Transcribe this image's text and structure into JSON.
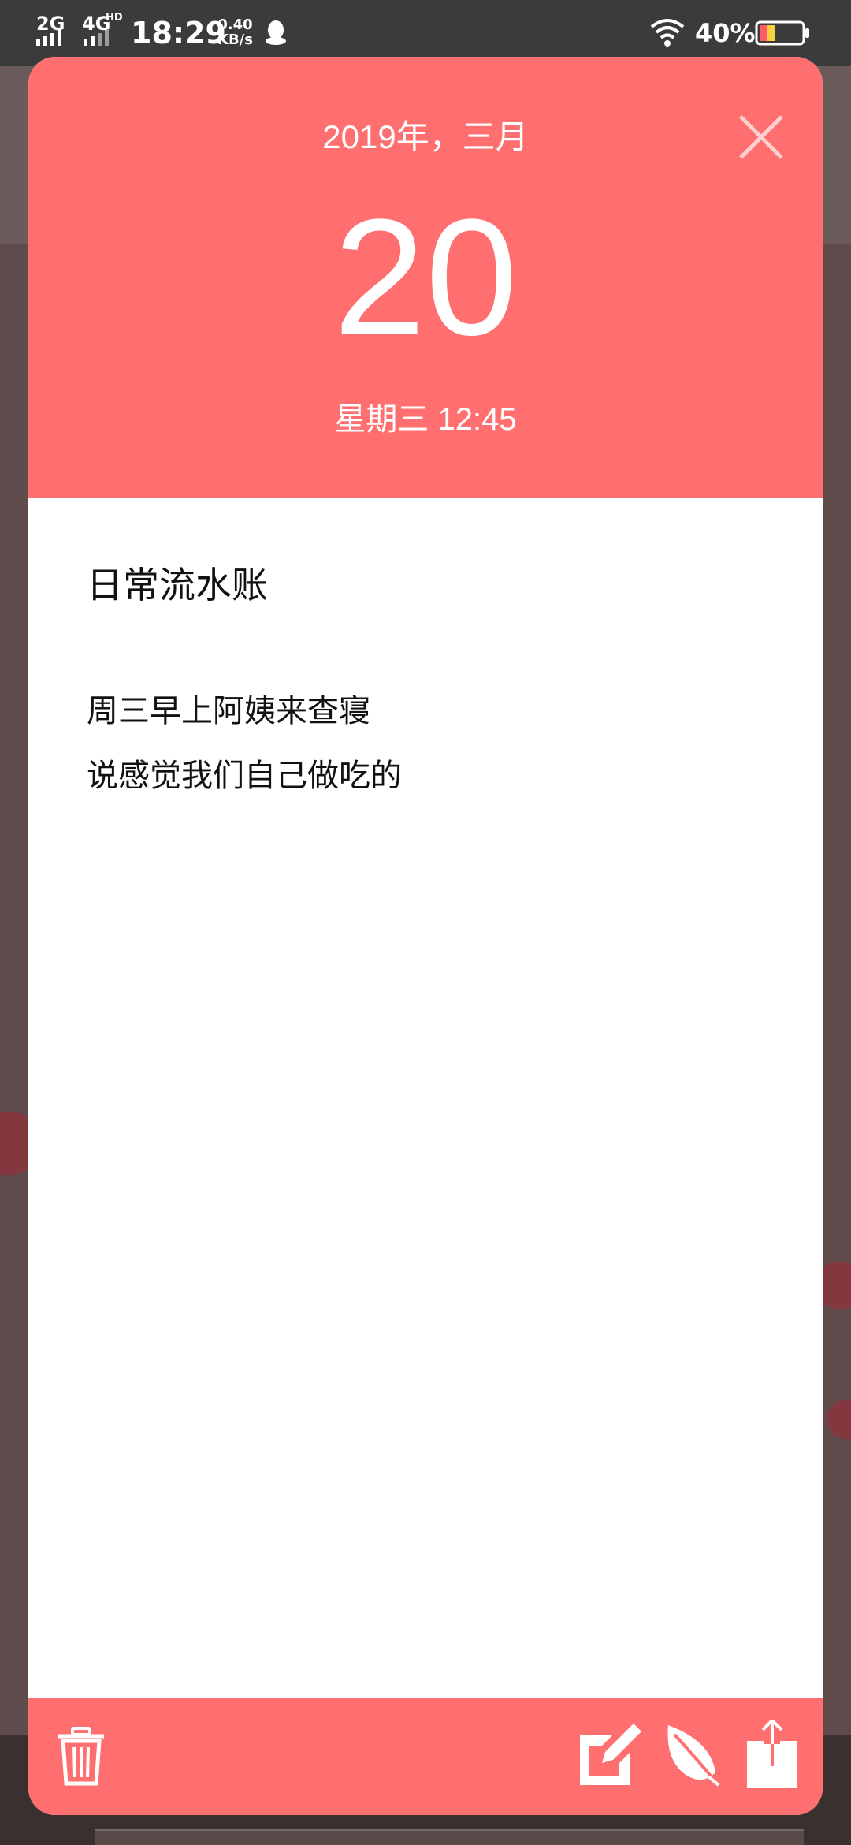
{
  "status_bar": {
    "sim1": "2G",
    "sim2": "4G",
    "sim2_hd": "HD",
    "time": "18:29",
    "net_speed_value": "0.40",
    "net_speed_unit": "KB/s",
    "battery": "40%"
  },
  "note": {
    "year_month": "2019年，三月",
    "day": "20",
    "weekday_time": "星期三 12:45",
    "title": "日常流水账",
    "lines": [
      "周三早上阿姨来查寝",
      "说感觉我们自己做吃的"
    ]
  },
  "toolbar": {
    "icons": [
      "trash-icon",
      "edit-icon",
      "leaf-icon",
      "share-icon"
    ]
  },
  "colors": {
    "accent": "#ff6f6f",
    "status_bar": "#3b3b3b",
    "text": "#111111"
  }
}
